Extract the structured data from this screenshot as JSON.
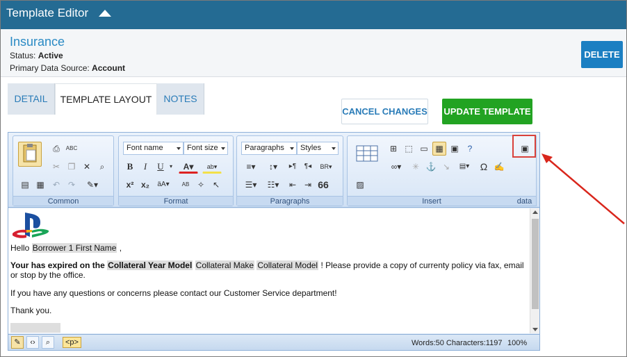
{
  "header": {
    "title": "Template Editor"
  },
  "record": {
    "name": "Insurance",
    "status_label": "Status:",
    "status_value": "Active",
    "source_label": "Primary Data Source:",
    "source_value": "Account",
    "delete_label": "DELETE"
  },
  "tabs": [
    {
      "label": "DETAIL"
    },
    {
      "label": "TEMPLATE LAYOUT"
    },
    {
      "label": "NOTES"
    }
  ],
  "actions": {
    "cancel_label": "CANCEL CHANGES",
    "update_label": "UPDATE TEMPLATE"
  },
  "toolbar": {
    "groups": [
      "Common",
      "Format",
      "Paragraphs",
      "Insert",
      "data"
    ],
    "font_name": "Font name",
    "font_size": "Font size",
    "paragraphs": "Paragraphs",
    "styles": "Styles",
    "bold": "B",
    "italic": "I",
    "underline": "U",
    "color_a": "A",
    "superscript": "x²",
    "subscript": "x₂",
    "omega": "Ω",
    "quote": "66"
  },
  "content": {
    "hello": "Hello",
    "borrower": "Borrower 1 First Name",
    "comma": ",",
    "line2_bold": "Your has expired on the",
    "collateral_year": "Collateral Year Model",
    "collateral_make": "Collateral Make",
    "collateral_model": "Collateral Model",
    "line2_rest": "! Please provide a copy of currenty policy via fax, email",
    "line2_wrap": "or stop by the office.",
    "line3": "If you have any questions or concerns please contact our Customer Service department!",
    "line4": "Thank you."
  },
  "status": {
    "ptag": "<p>",
    "counts": "Words:50 Characters:1197",
    "zoom": "100%"
  },
  "colors": {
    "header": "#246b93",
    "accent": "#1b7fc2",
    "update": "#22a322",
    "highlight": "#d9413a"
  }
}
